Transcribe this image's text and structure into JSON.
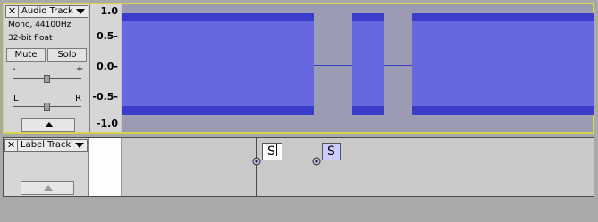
{
  "audio_track": {
    "close_icon": "close-icon",
    "name": "Audio Track",
    "format": "Mono, 44100Hz",
    "bit_depth": "32-bit float",
    "mute_label": "Mute",
    "solo_label": "Solo",
    "gain_minus": "-",
    "gain_plus": "+",
    "pan_left": "L",
    "pan_right": "R",
    "scale_labels": [
      "1.0",
      "0.5-",
      "0.0-",
      "-0.5-",
      "-1.0"
    ]
  },
  "label_track": {
    "name": "Label Track",
    "labels": [
      {
        "text": "S",
        "editing": true
      },
      {
        "text": "S",
        "editing": false
      }
    ]
  },
  "colors": {
    "waveform_outer": "#3b3bcc",
    "waveform_inner": "#6767e0",
    "selected_border": "#d6d34a",
    "label_selected_bg": "#ccccff",
    "label_edit_bg": "#ffffff"
  }
}
